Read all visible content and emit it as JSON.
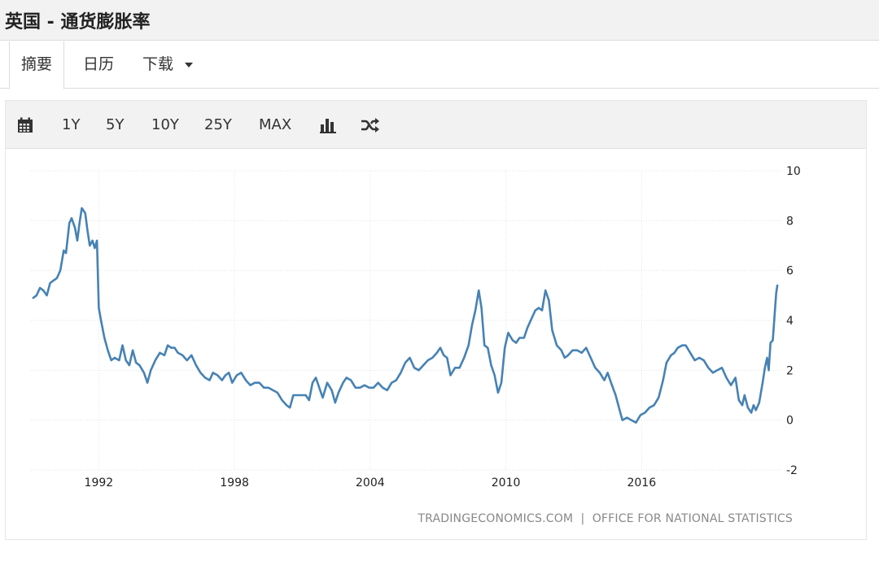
{
  "header": {
    "title": "英国 - 通货膨胀率"
  },
  "tabs": [
    {
      "label": "摘要",
      "active": true
    },
    {
      "label": "日历",
      "active": false
    },
    {
      "label": "下载",
      "active": false,
      "dropdown": true
    }
  ],
  "toolbar": {
    "calendar_icon": "calendar-icon",
    "ranges": [
      "1Y",
      "5Y",
      "10Y",
      "25Y",
      "MAX"
    ],
    "bar_icon": "bar-chart-icon",
    "shuffle_icon": "shuffle-icon"
  },
  "colors": {
    "line": "#4682b4",
    "grid": "#e3e3e3",
    "text": "#222222",
    "source": "#888888"
  },
  "source": "TRADINGECONOMICS.COM  |  OFFICE FOR NATIONAL STATISTICS",
  "chart_data": {
    "type": "line",
    "title": "",
    "xlabel": "",
    "ylabel": "",
    "ylim": [
      -2,
      10
    ],
    "xlim": [
      1989.0,
      2022.25
    ],
    "y_ticks": [
      10,
      8,
      6,
      4,
      2,
      0,
      -2
    ],
    "x_ticks": [
      1992,
      1998,
      2004,
      2010,
      2016
    ],
    "y_axis_side": "right",
    "grid": true,
    "series": [
      {
        "values": [
          [
            1989.1,
            4.9
          ],
          [
            1989.25,
            5.0
          ],
          [
            1989.4,
            5.3
          ],
          [
            1989.55,
            5.2
          ],
          [
            1989.7,
            5.0
          ],
          [
            1989.85,
            5.5
          ],
          [
            1990.0,
            5.6
          ],
          [
            1990.15,
            5.7
          ],
          [
            1990.3,
            6.0
          ],
          [
            1990.45,
            6.8
          ],
          [
            1990.55,
            6.7
          ],
          [
            1990.7,
            7.9
          ],
          [
            1990.8,
            8.1
          ],
          [
            1990.95,
            7.7
          ],
          [
            1991.05,
            7.2
          ],
          [
            1991.15,
            7.9
          ],
          [
            1991.25,
            8.5
          ],
          [
            1991.4,
            8.3
          ],
          [
            1991.5,
            7.6
          ],
          [
            1991.6,
            7.0
          ],
          [
            1991.72,
            7.2
          ],
          [
            1991.82,
            6.9
          ],
          [
            1991.92,
            7.2
          ],
          [
            1992.0,
            4.5
          ],
          [
            1992.1,
            4.0
          ],
          [
            1992.25,
            3.3
          ],
          [
            1992.4,
            2.8
          ],
          [
            1992.55,
            2.4
          ],
          [
            1992.7,
            2.5
          ],
          [
            1992.9,
            2.4
          ],
          [
            1993.05,
            3.0
          ],
          [
            1993.2,
            2.4
          ],
          [
            1993.35,
            2.2
          ],
          [
            1993.5,
            2.8
          ],
          [
            1993.65,
            2.3
          ],
          [
            1993.8,
            2.2
          ],
          [
            1994.0,
            1.9
          ],
          [
            1994.15,
            1.5
          ],
          [
            1994.3,
            2.0
          ],
          [
            1994.5,
            2.4
          ],
          [
            1994.7,
            2.7
          ],
          [
            1994.9,
            2.6
          ],
          [
            1995.05,
            3.0
          ],
          [
            1995.2,
            2.9
          ],
          [
            1995.35,
            2.9
          ],
          [
            1995.5,
            2.7
          ],
          [
            1995.7,
            2.6
          ],
          [
            1995.9,
            2.4
          ],
          [
            1996.1,
            2.6
          ],
          [
            1996.3,
            2.2
          ],
          [
            1996.5,
            1.9
          ],
          [
            1996.7,
            1.7
          ],
          [
            1996.9,
            1.6
          ],
          [
            1997.05,
            1.9
          ],
          [
            1997.25,
            1.8
          ],
          [
            1997.45,
            1.6
          ],
          [
            1997.6,
            1.8
          ],
          [
            1997.75,
            1.9
          ],
          [
            1997.9,
            1.5
          ],
          [
            1998.1,
            1.8
          ],
          [
            1998.3,
            1.9
          ],
          [
            1998.5,
            1.6
          ],
          [
            1998.7,
            1.4
          ],
          [
            1998.9,
            1.5
          ],
          [
            1999.1,
            1.5
          ],
          [
            1999.3,
            1.3
          ],
          [
            1999.5,
            1.3
          ],
          [
            1999.7,
            1.2
          ],
          [
            1999.9,
            1.1
          ],
          [
            2000.1,
            0.8
          ],
          [
            2000.3,
            0.6
          ],
          [
            2000.45,
            0.5
          ],
          [
            2000.6,
            1.0
          ],
          [
            2000.8,
            1.0
          ],
          [
            2000.95,
            1.0
          ],
          [
            2001.15,
            1.0
          ],
          [
            2001.3,
            0.8
          ],
          [
            2001.45,
            1.5
          ],
          [
            2001.6,
            1.7
          ],
          [
            2001.75,
            1.3
          ],
          [
            2001.9,
            0.9
          ],
          [
            2002.1,
            1.5
          ],
          [
            2002.3,
            1.2
          ],
          [
            2002.45,
            0.7
          ],
          [
            2002.6,
            1.1
          ],
          [
            2002.8,
            1.5
          ],
          [
            2002.95,
            1.7
          ],
          [
            2003.15,
            1.6
          ],
          [
            2003.35,
            1.3
          ],
          [
            2003.55,
            1.3
          ],
          [
            2003.75,
            1.4
          ],
          [
            2003.95,
            1.3
          ],
          [
            2004.15,
            1.3
          ],
          [
            2004.35,
            1.5
          ],
          [
            2004.55,
            1.3
          ],
          [
            2004.75,
            1.2
          ],
          [
            2004.95,
            1.5
          ],
          [
            2005.15,
            1.6
          ],
          [
            2005.35,
            1.9
          ],
          [
            2005.55,
            2.3
          ],
          [
            2005.75,
            2.5
          ],
          [
            2005.95,
            2.1
          ],
          [
            2006.15,
            2.0
          ],
          [
            2006.35,
            2.2
          ],
          [
            2006.55,
            2.4
          ],
          [
            2006.75,
            2.5
          ],
          [
            2006.95,
            2.7
          ],
          [
            2007.1,
            2.9
          ],
          [
            2007.25,
            2.6
          ],
          [
            2007.4,
            2.5
          ],
          [
            2007.55,
            1.8
          ],
          [
            2007.75,
            2.1
          ],
          [
            2007.95,
            2.1
          ],
          [
            2008.15,
            2.5
          ],
          [
            2008.35,
            3.0
          ],
          [
            2008.5,
            3.8
          ],
          [
            2008.65,
            4.4
          ],
          [
            2008.8,
            5.2
          ],
          [
            2008.92,
            4.5
          ],
          [
            2009.05,
            3.0
          ],
          [
            2009.2,
            2.9
          ],
          [
            2009.35,
            2.2
          ],
          [
            2009.5,
            1.8
          ],
          [
            2009.65,
            1.1
          ],
          [
            2009.8,
            1.5
          ],
          [
            2009.95,
            2.9
          ],
          [
            2010.1,
            3.5
          ],
          [
            2010.3,
            3.2
          ],
          [
            2010.45,
            3.1
          ],
          [
            2010.6,
            3.3
          ],
          [
            2010.8,
            3.3
          ],
          [
            2010.95,
            3.7
          ],
          [
            2011.1,
            4.0
          ],
          [
            2011.3,
            4.4
          ],
          [
            2011.45,
            4.5
          ],
          [
            2011.6,
            4.4
          ],
          [
            2011.75,
            5.2
          ],
          [
            2011.9,
            4.8
          ],
          [
            2012.05,
            3.6
          ],
          [
            2012.25,
            3.0
          ],
          [
            2012.45,
            2.8
          ],
          [
            2012.6,
            2.5
          ],
          [
            2012.75,
            2.6
          ],
          [
            2012.95,
            2.8
          ],
          [
            2013.15,
            2.8
          ],
          [
            2013.35,
            2.7
          ],
          [
            2013.55,
            2.9
          ],
          [
            2013.75,
            2.5
          ],
          [
            2013.95,
            2.1
          ],
          [
            2014.15,
            1.9
          ],
          [
            2014.35,
            1.6
          ],
          [
            2014.5,
            1.9
          ],
          [
            2014.65,
            1.5
          ],
          [
            2014.85,
            1.0
          ],
          [
            2015.0,
            0.5
          ],
          [
            2015.15,
            0.0
          ],
          [
            2015.35,
            0.1
          ],
          [
            2015.55,
            0.0
          ],
          [
            2015.75,
            -0.1
          ],
          [
            2015.95,
            0.2
          ],
          [
            2016.15,
            0.3
          ],
          [
            2016.35,
            0.5
          ],
          [
            2016.55,
            0.6
          ],
          [
            2016.75,
            0.9
          ],
          [
            2016.95,
            1.6
          ],
          [
            2017.1,
            2.3
          ],
          [
            2017.3,
            2.6
          ],
          [
            2017.45,
            2.7
          ],
          [
            2017.6,
            2.9
          ],
          [
            2017.8,
            3.0
          ],
          [
            2017.95,
            3.0
          ],
          [
            2018.15,
            2.7
          ],
          [
            2018.35,
            2.4
          ],
          [
            2018.55,
            2.5
          ],
          [
            2018.75,
            2.4
          ],
          [
            2018.95,
            2.1
          ],
          [
            2019.15,
            1.9
          ],
          [
            2019.35,
            2.0
          ],
          [
            2019.55,
            2.1
          ],
          [
            2019.75,
            1.7
          ],
          [
            2019.95,
            1.4
          ],
          [
            2020.15,
            1.7
          ],
          [
            2020.3,
            0.8
          ],
          [
            2020.45,
            0.6
          ],
          [
            2020.55,
            1.0
          ],
          [
            2020.7,
            0.5
          ],
          [
            2020.85,
            0.3
          ],
          [
            2020.95,
            0.6
          ],
          [
            2021.05,
            0.4
          ],
          [
            2021.2,
            0.7
          ],
          [
            2021.35,
            1.5
          ],
          [
            2021.45,
            2.1
          ],
          [
            2021.55,
            2.5
          ],
          [
            2021.62,
            2.0
          ],
          [
            2021.7,
            3.1
          ],
          [
            2021.8,
            3.2
          ],
          [
            2021.88,
            4.2
          ],
          [
            2021.95,
            5.1
          ],
          [
            2022.0,
            5.4
          ]
        ]
      }
    ]
  }
}
